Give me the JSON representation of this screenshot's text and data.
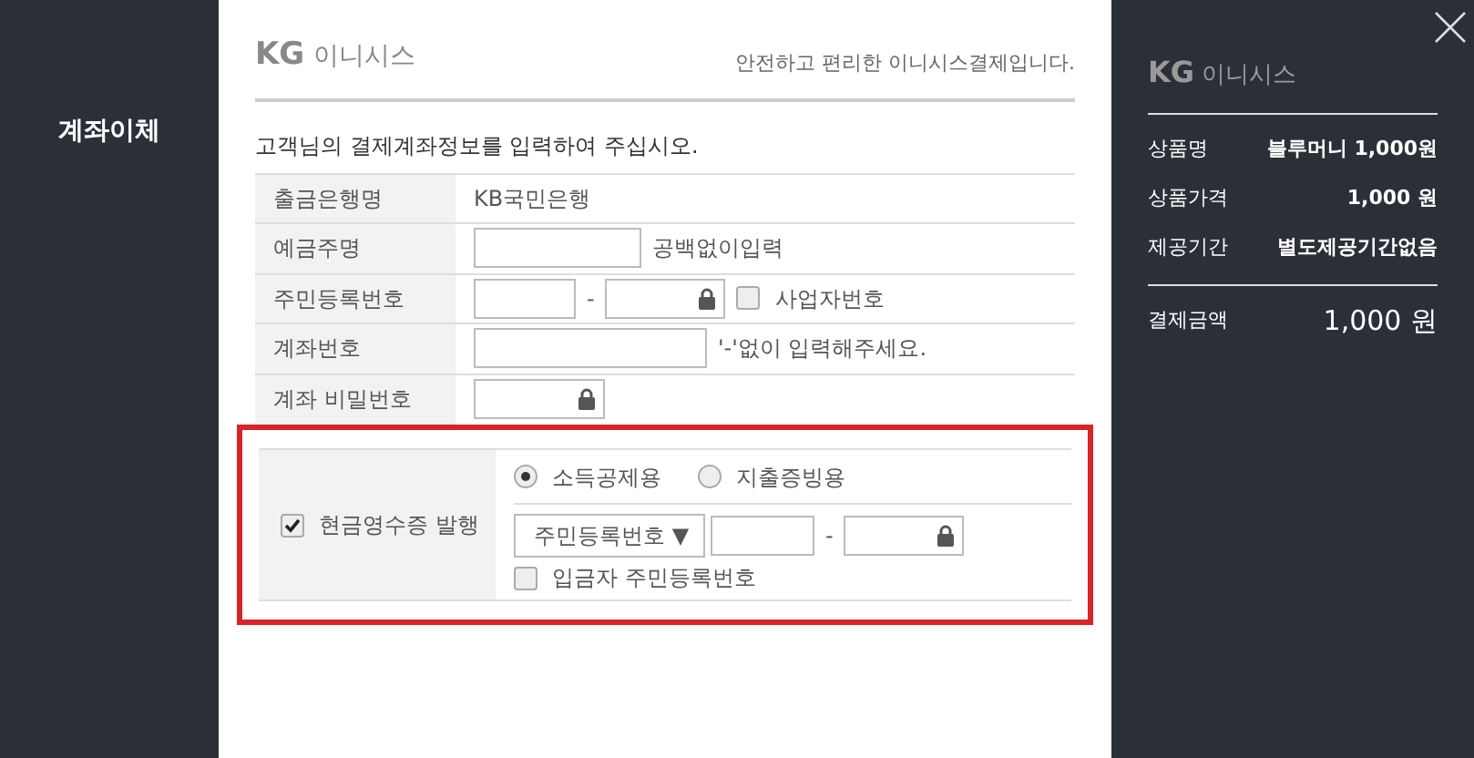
{
  "sidebar": {
    "title": "계좌이체"
  },
  "header": {
    "logo_mark": "KG",
    "logo_text": "이니시스",
    "tagline": "안전하고 편리한 이니시스결제입니다."
  },
  "instruction": "고객님의 결제계좌정보를 입력하여 주십시오.",
  "form_rows": [
    {
      "kind": "text",
      "label": "출금은행명",
      "value": "KB국민은행"
    },
    {
      "kind": "name",
      "label": "예금주명",
      "hint": "공백없이입력"
    },
    {
      "kind": "resident",
      "label": "주민등록번호",
      "separator": "-",
      "checkbox": {
        "label": "사업자번호",
        "checked": false
      }
    },
    {
      "kind": "account",
      "label": "계좌번호",
      "hint": "'-'없이 입력해주세요."
    },
    {
      "kind": "password",
      "label": "계좌 비밀번호"
    }
  ],
  "cash_receipt": {
    "highlighted": true,
    "label": "현금영수증 발행",
    "checked": true,
    "options": [
      {
        "label": "소득공제용",
        "selected": true
      },
      {
        "label": "지출증빙용",
        "selected": false
      }
    ],
    "id_type": "주민등록번호 ▼",
    "separator": "-",
    "depositor_checkbox": {
      "label": "입금자 주민등록번호",
      "checked": false
    }
  },
  "summary": {
    "logo_mark": "KG",
    "logo_text": "이니시스",
    "items": [
      {
        "label": "상품명",
        "value": "블루머니 1,000원"
      },
      {
        "label": "상품가격",
        "value": "1,000 원"
      },
      {
        "label": "제공기간",
        "value": "별도제공기간없음"
      }
    ],
    "total": {
      "label": "결제금액",
      "value": "1,000 원"
    }
  }
}
